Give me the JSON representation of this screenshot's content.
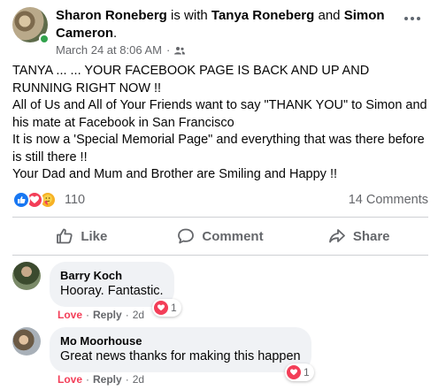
{
  "post": {
    "author": "Sharon Roneberg",
    "with_text": "is with",
    "tagged_1": "Tanya Roneberg",
    "and_text": "and",
    "tagged_2": "Simon Cameron",
    "period": ".",
    "timestamp": "March 24 at 8:06 AM",
    "separator": "·",
    "privacy_icon": "friends-icon",
    "body_lines": [
      "TANYA ... ... YOUR FACEBOOK PAGE IS BACK AND UP AND RUNNING RIGHT NOW !!",
      "All of Us and All of Your Friends want to say \"THANK YOU\" to Simon and his mate at Facebook in San Francisco",
      "It is now a 'Special Memorial Page\" and everything that was there before is still there !!",
      "Your Dad and Mum and Brother are Smiling and Happy !!"
    ]
  },
  "reactions": {
    "icons": [
      "like-icon",
      "love-icon",
      "care-icon"
    ],
    "count": "110",
    "comments_label": "14 Comments"
  },
  "actions": {
    "like": "Like",
    "comment": "Comment",
    "share": "Share"
  },
  "comments": [
    {
      "name": "Barry Koch",
      "text": "Hooray. Fantastic.",
      "reaction_label": "Love",
      "reply_label": "Reply",
      "dot": "·",
      "age": "2d",
      "reaction_count": "1"
    },
    {
      "name": "Mo Moorhouse",
      "text": "Great news thanks for making this happen",
      "reaction_label": "Love",
      "reply_label": "Reply",
      "dot": "·",
      "age": "2d",
      "reaction_count": "1"
    }
  ],
  "colors": {
    "like_blue": "#1877f2",
    "love_red": "#f33e58",
    "care_yellow": "#f7b125",
    "meta_gray": "#65676b",
    "bubble_gray": "#f0f2f5",
    "online_green": "#31a24c"
  }
}
